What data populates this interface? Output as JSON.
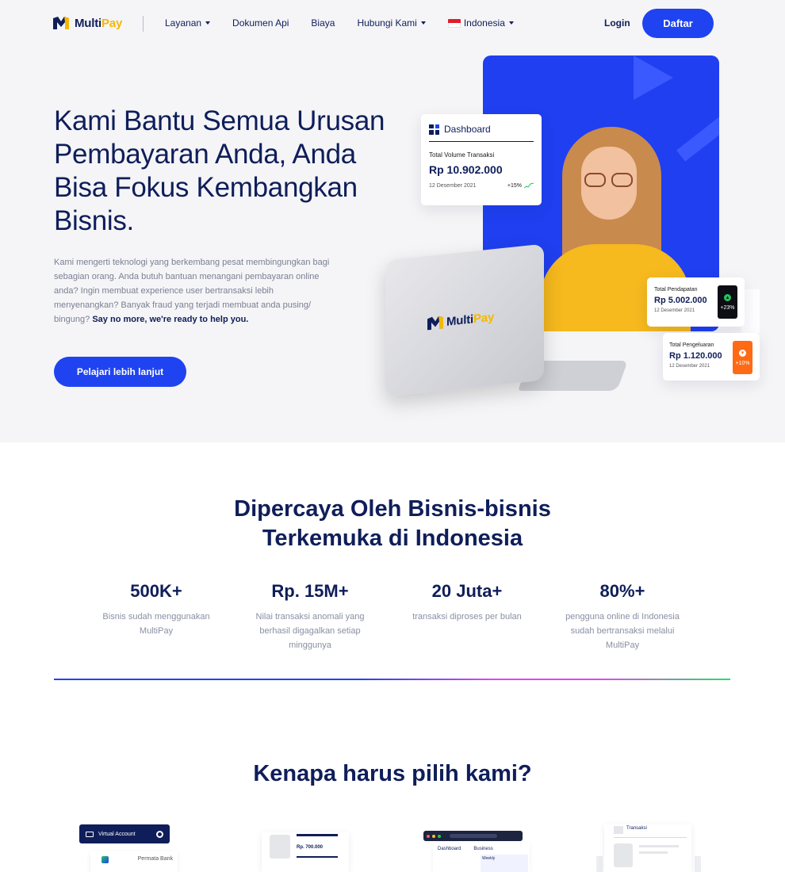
{
  "header": {
    "logo_multi": "Multi",
    "logo_pay": "Pay",
    "nav": [
      {
        "label": "Layanan",
        "dropdown": true
      },
      {
        "label": "Dokumen Api",
        "dropdown": false
      },
      {
        "label": "Biaya",
        "dropdown": false
      },
      {
        "label": "Hubungi Kami",
        "dropdown": true
      }
    ],
    "language": "Indonesia",
    "login": "Login",
    "register": "Daftar"
  },
  "hero": {
    "title": "Kami Bantu Semua Urusan Pembayaran Anda, Anda Bisa Fokus Kembangkan Bisnis.",
    "description": "Kami mengerti teknologi yang berkembang pesat membingungkan bagi sebagian orang. Anda butuh bantuan menangani pembayaran online anda? Ingin membuat experience user bertransaksi lebih menyenangkan? Banyak fraud yang terjadi membuat anda pusing/ bingung?",
    "description_strong": "Say no more, we're ready to help you.",
    "cta": "Pelajari lebih lanjut"
  },
  "illustration": {
    "laptop_logo_multi": "Multi",
    "laptop_logo_pay": "Pay",
    "dashboard": {
      "title": "Dashboard",
      "label": "Total Volume Transaksi",
      "value": "Rp 10.902.000",
      "date": "12 Desember 2021",
      "trend": "+15%"
    },
    "income": {
      "label": "Total Pendapatan",
      "value": "Rp 5.002.000",
      "date": "12 Desember 2021",
      "badge": "+23%"
    },
    "expense": {
      "label": "Total Pengeluaran",
      "value": "Rp 1.120.000",
      "date": "12 Desember 2021",
      "badge": "+10%"
    }
  },
  "stats": {
    "title_line1": "Dipercaya Oleh Bisnis-bisnis",
    "title_line2": "Terkemuka di Indonesia",
    "items": [
      {
        "value": "500K+",
        "desc": "Bisnis sudah menggunakan MultiPay"
      },
      {
        "value": "Rp. 15M+",
        "desc": "Nilai transaksi anomali yang berhasil digagalkan setiap minggunya"
      },
      {
        "value": "20 Juta+",
        "desc": "transaksi diproses per bulan"
      },
      {
        "value": "80%+",
        "desc": "pengguna online di Indonesia sudah bertransaksi melalui MultiPay"
      }
    ]
  },
  "why": {
    "title": "Kenapa harus pilih kami?",
    "f1_bar": "Virtual Account",
    "f1_bank": "Permata Bank",
    "f2_value": "Rp. 700.000",
    "f3_tab1": "Dashboard",
    "f3_tab2": "Business",
    "f3_chart": "Weekly",
    "f4_title": "Transaksi"
  },
  "colors": {
    "primary": "#1f43f0",
    "navy": "#0f1e5a",
    "accent_yellow": "#f5b800",
    "orange": "#ff6a14",
    "green": "#22c55e"
  }
}
